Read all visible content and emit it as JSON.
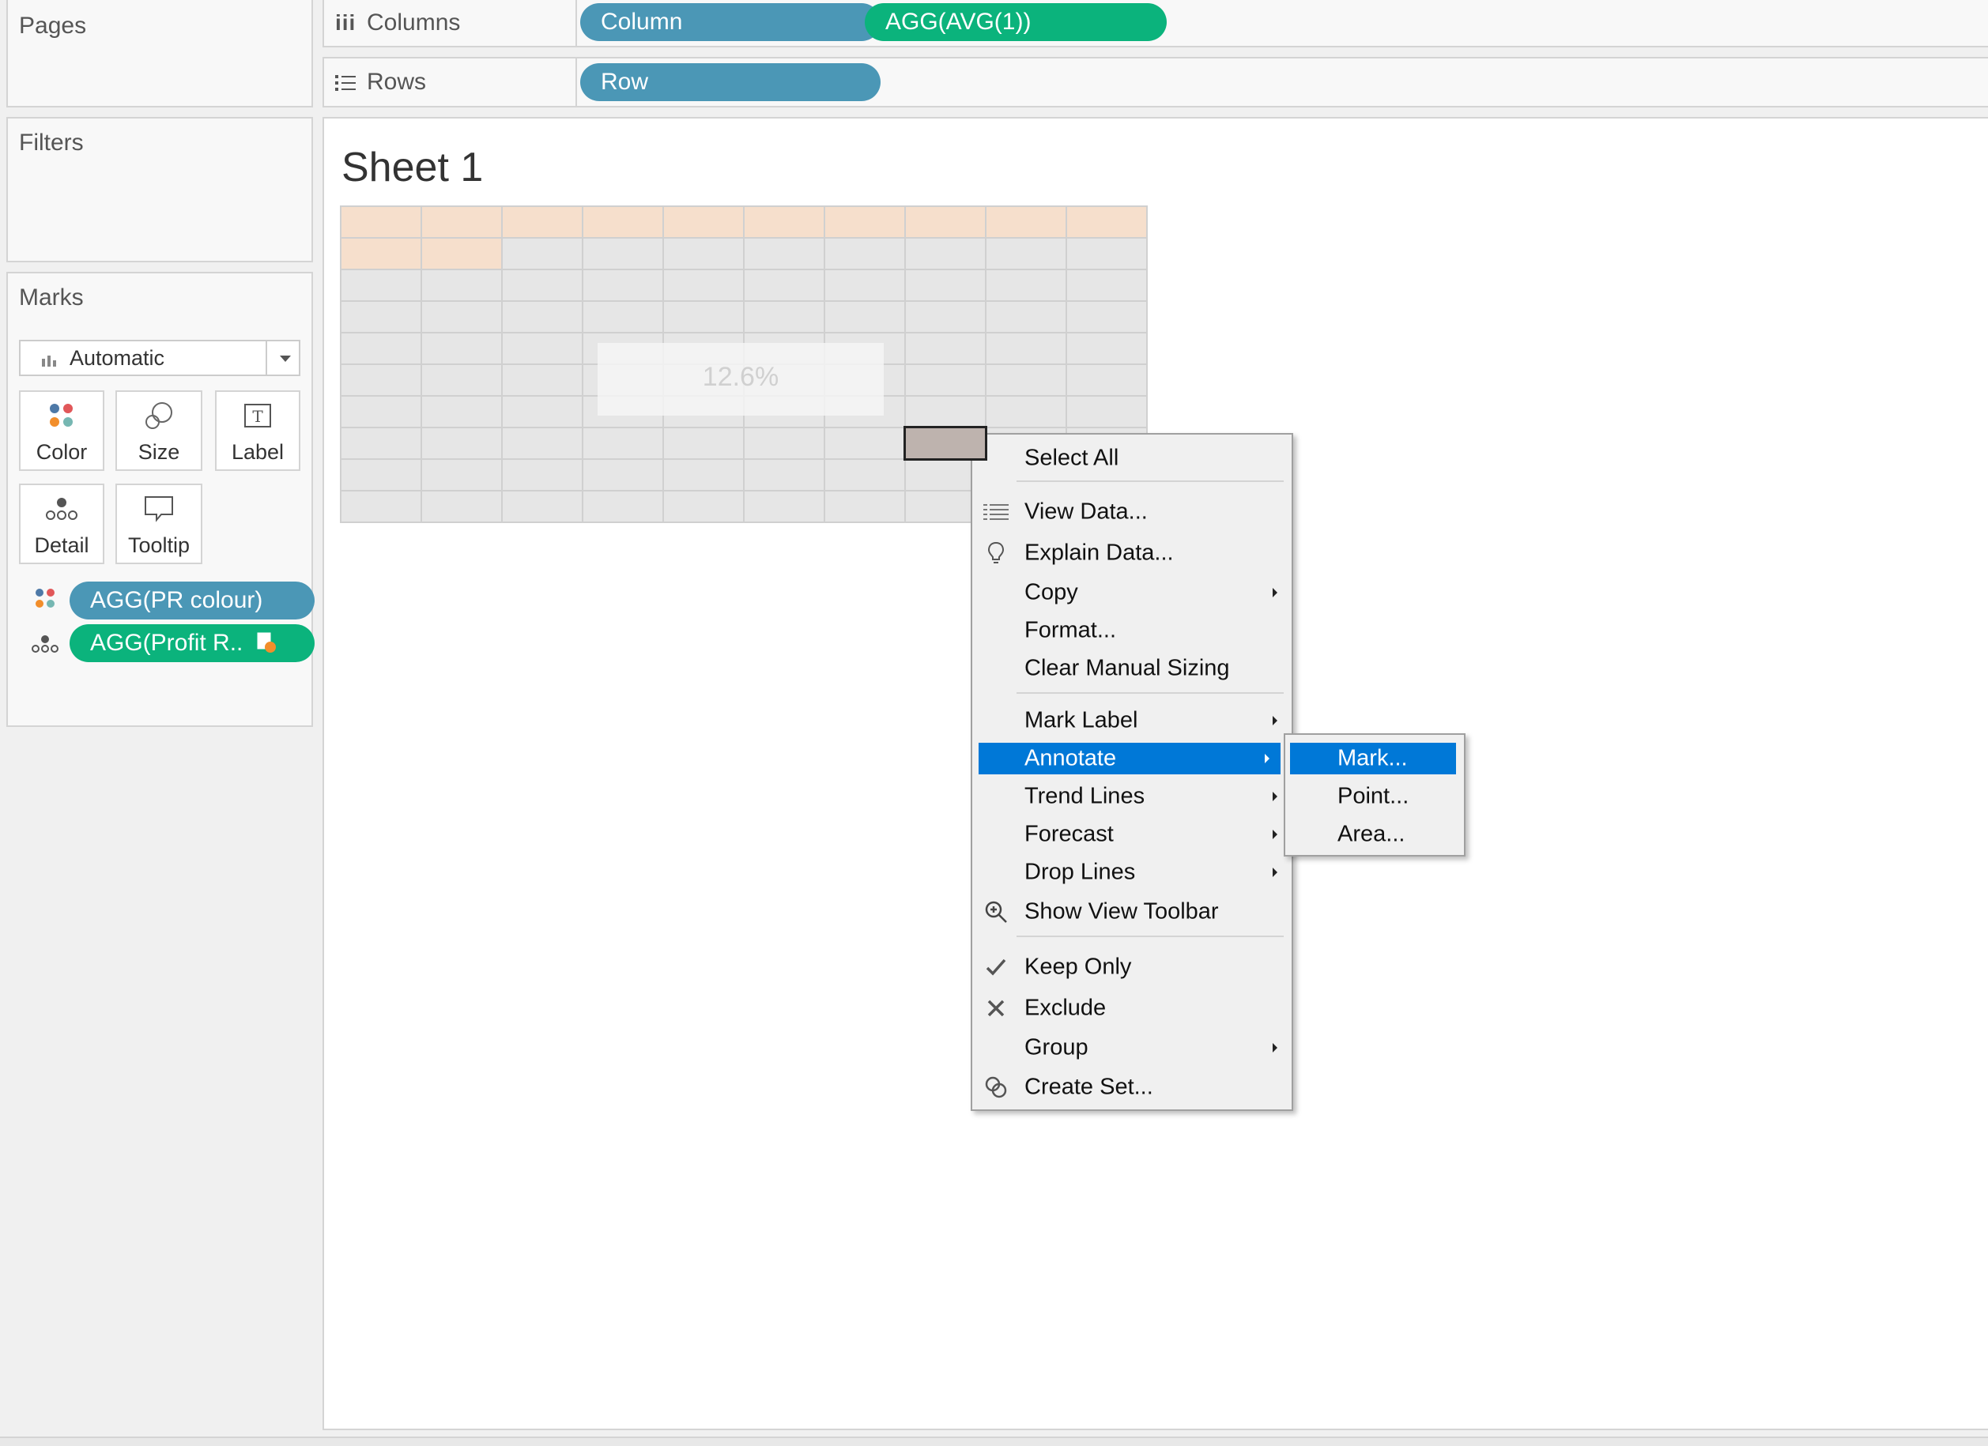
{
  "pages_card": {
    "title": "Pages"
  },
  "filters_card": {
    "title": "Filters"
  },
  "marks_card": {
    "title": "Marks",
    "mark_type": "Automatic",
    "buttons": {
      "color": "Color",
      "size": "Size",
      "label": "Label",
      "detail": "Detail",
      "tooltip": "Tooltip"
    },
    "pills": [
      {
        "label": "AGG(PR colour)",
        "kind": "color",
        "color": "#4b97b6"
      },
      {
        "label": "AGG(Profit R..",
        "kind": "detail",
        "color": "#0bb37c"
      }
    ]
  },
  "columns_shelf": {
    "label": "Columns",
    "icon": "columns-icon",
    "pills": [
      {
        "label": "Column",
        "color": "#4b97b6"
      },
      {
        "label": "AGG(AVG(1))",
        "color": "#0bb37c"
      }
    ]
  },
  "rows_shelf": {
    "label": "Rows",
    "icon": "rows-icon",
    "pills": [
      {
        "label": "Row",
        "color": "#4b97b6"
      }
    ]
  },
  "sheet": {
    "title": "Sheet 1",
    "grid": {
      "columns": 10,
      "rows": 10,
      "cell_color": "#e6e6e6",
      "highlight_color": "#f6dfcc",
      "selected_color": "#beb3ae",
      "highlighted_cells": 12
    },
    "tooltip_value": "12.6%"
  },
  "context_menu": {
    "items": [
      {
        "label": "Select All"
      },
      {
        "label": "View Data...",
        "icon": "view-data-icon"
      },
      {
        "label": "Explain Data...",
        "icon": "lightbulb-icon"
      },
      {
        "label": "Copy",
        "submenu": true
      },
      {
        "label": "Format..."
      },
      {
        "label": "Clear Manual Sizing"
      },
      {
        "label": "Mark Label",
        "submenu": true
      },
      {
        "label": "Annotate",
        "submenu": true,
        "highlighted": true
      },
      {
        "label": "Trend Lines",
        "submenu": true
      },
      {
        "label": "Forecast",
        "submenu": true
      },
      {
        "label": "Drop Lines",
        "submenu": true
      },
      {
        "label": "Show View Toolbar",
        "icon": "zoom-in-icon"
      },
      {
        "label": "Keep Only",
        "icon": "checkmark-icon"
      },
      {
        "label": "Exclude",
        "icon": "x-icon"
      },
      {
        "label": "Group",
        "submenu": true
      },
      {
        "label": "Create Set...",
        "icon": "create-set-icon"
      }
    ],
    "annotate_submenu": [
      {
        "label": "Mark...",
        "highlighted": true
      },
      {
        "label": "Point..."
      },
      {
        "label": "Area..."
      }
    ],
    "highlight_color": "#0078d7"
  }
}
